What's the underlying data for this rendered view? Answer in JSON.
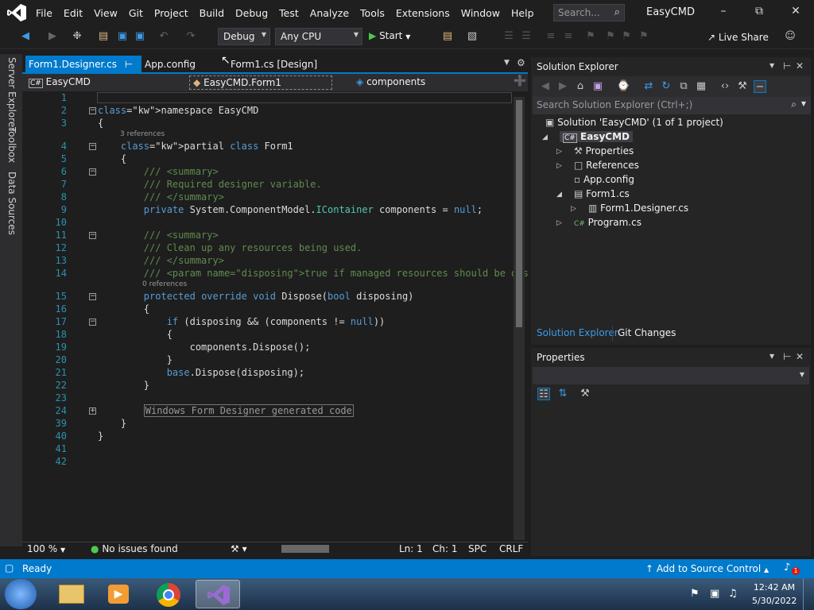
{
  "menu": [
    "File",
    "Edit",
    "View",
    "Git",
    "Project",
    "Build",
    "Debug",
    "Test",
    "Analyze",
    "Tools",
    "Extensions",
    "Window",
    "Help"
  ],
  "search_placeholder": "Search...",
  "app_name": "EasyCMD",
  "toolbar": {
    "config": "Debug",
    "platform": "Any CPU",
    "start_label": "Start",
    "live_share": "Live Share"
  },
  "left_rail": [
    "Server Explorer",
    "Toolbox",
    "Data Sources"
  ],
  "tabs": [
    "Form1.Designer.cs",
    "App.config",
    "Form1.cs [Design]"
  ],
  "navbar": {
    "project": "EasyCMD",
    "class": "EasyCMD.Form1",
    "member": "components"
  },
  "code_lines": [
    {
      "n": "1",
      "text": ""
    },
    {
      "n": "2",
      "text": "namespace EasyCMD"
    },
    {
      "n": "3",
      "text": "{"
    },
    {
      "n": "4",
      "text": "    partial class Form1"
    },
    {
      "n": "5",
      "text": "    {"
    },
    {
      "n": "6",
      "text": "        /// <summary>"
    },
    {
      "n": "7",
      "text": "        /// Required designer variable."
    },
    {
      "n": "8",
      "text": "        /// </summary>"
    },
    {
      "n": "9",
      "text": "        private System.ComponentModel.IContainer components = null;"
    },
    {
      "n": "10",
      "text": ""
    },
    {
      "n": "11",
      "text": "        /// <summary>"
    },
    {
      "n": "12",
      "text": "        /// Clean up any resources being used."
    },
    {
      "n": "13",
      "text": "        /// </summary>"
    },
    {
      "n": "14",
      "text": "        /// <param name=\"disposing\">true if managed resources should be dis"
    },
    {
      "n": "15",
      "text": "        protected override void Dispose(bool disposing)"
    },
    {
      "n": "16",
      "text": "        {"
    },
    {
      "n": "17",
      "text": "            if (disposing && (components != null))"
    },
    {
      "n": "18",
      "text": "            {"
    },
    {
      "n": "19",
      "text": "                components.Dispose();"
    },
    {
      "n": "20",
      "text": "            }"
    },
    {
      "n": "21",
      "text": "            base.Dispose(disposing);"
    },
    {
      "n": "22",
      "text": "        }"
    },
    {
      "n": "23",
      "text": ""
    },
    {
      "n": "24",
      "text": "        Windows Form Designer generated code"
    },
    {
      "n": "39",
      "text": "    }"
    },
    {
      "n": "40",
      "text": "}"
    },
    {
      "n": "41",
      "text": ""
    },
    {
      "n": "42",
      "text": ""
    }
  ],
  "refs": {
    "class_refs": "3 references",
    "dispose_refs": "0 references"
  },
  "editor_status": {
    "zoom": "100 %",
    "issues": "No issues found",
    "ln": "Ln: 1",
    "ch": "Ch: 1",
    "spc": "SPC",
    "crlf": "CRLF"
  },
  "solution_explorer": {
    "title": "Solution Explorer",
    "search_placeholder": "Search Solution Explorer (Ctrl+;)",
    "solution": "Solution 'EasyCMD' (1 of 1 project)",
    "project": "EasyCMD",
    "items": [
      "Properties",
      "References",
      "App.config",
      "Form1.cs",
      "Form1.Designer.cs",
      "Program.cs"
    ],
    "tab_active": "Solution Explorer",
    "tab_other": "Git Changes"
  },
  "properties_title": "Properties",
  "status": {
    "ready": "Ready",
    "source_control": "Add to Source Control",
    "notif_count": "1"
  },
  "clock": {
    "time": "12:42 AM",
    "date": "5/30/2022"
  },
  "colors": {
    "accent": "#007acc",
    "titlebar": "#1f1f1f",
    "editor_bg": "#1e1e1e"
  }
}
